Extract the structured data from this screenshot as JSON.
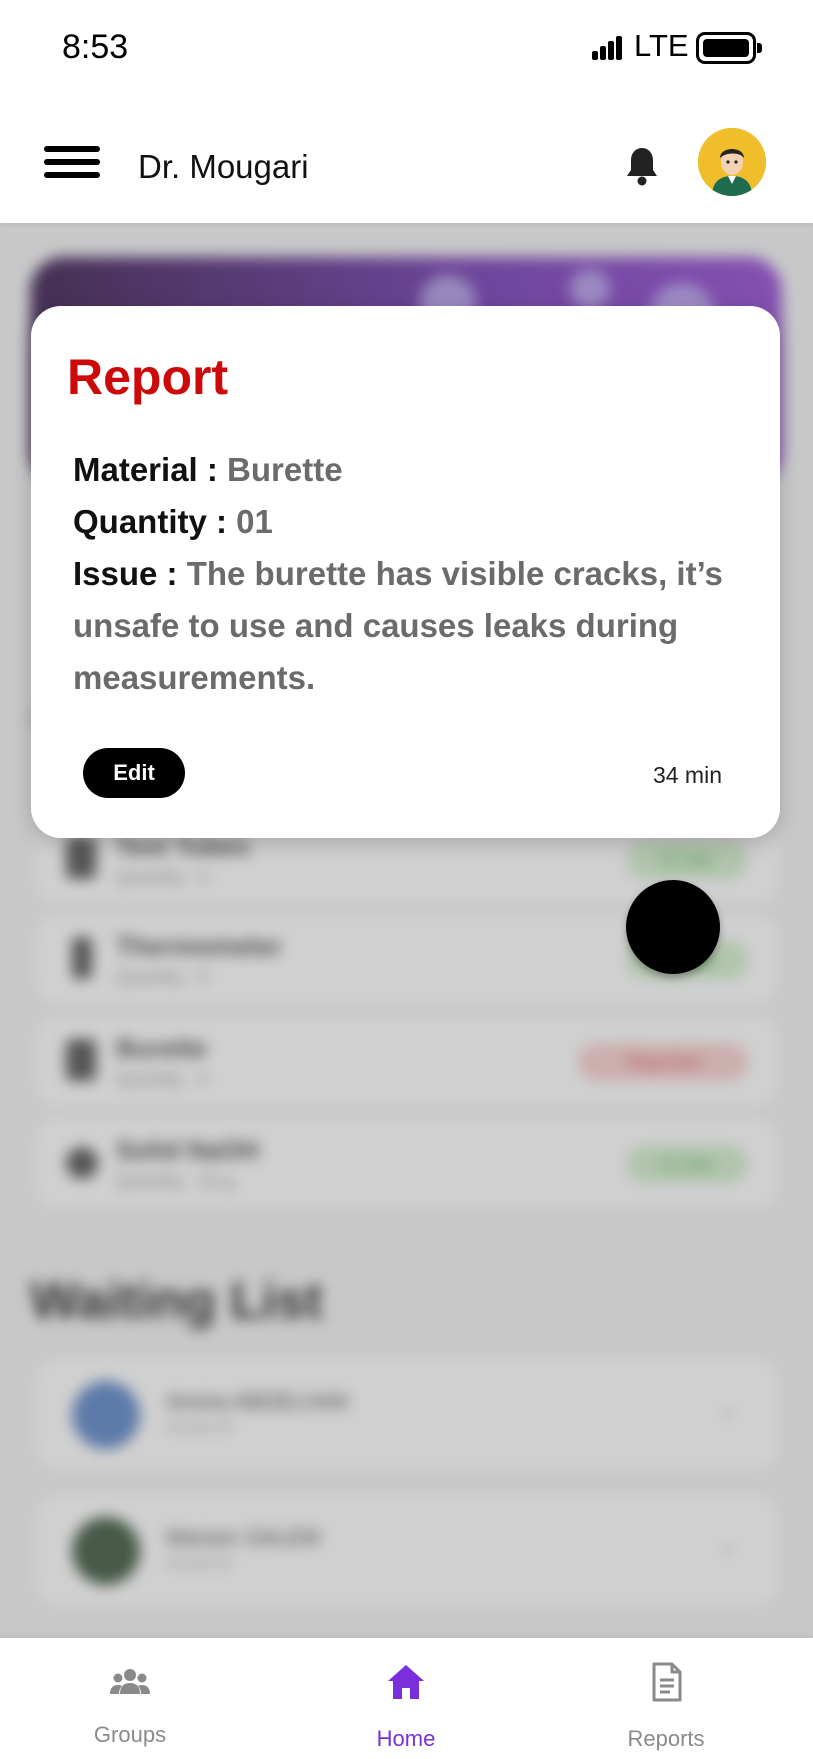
{
  "status_bar": {
    "time": "8:53",
    "network": "LTE"
  },
  "header": {
    "title": "Dr. Mougari",
    "menu_icon": "hamburger-icon",
    "bell_icon": "bell-icon",
    "avatar": "avatar"
  },
  "report": {
    "title": "Report",
    "material_label": "Material :",
    "material_value": "Burette",
    "quantity_label": "Quantity :",
    "quantity_value": "01",
    "issue_label": "Issue :",
    "issue_value": "The burette has visible cracks, it’s unsafe to use and causes leaks during measurements.",
    "edit_label": "Edit",
    "time": "34 min",
    "title_color": "#cc0a0a"
  },
  "background": {
    "materials": [
      {
        "name": "Test Tubes",
        "qty": "Quantity : 4",
        "status": "In Use",
        "status_type": "green"
      },
      {
        "name": "Thermometer",
        "qty": "Quantity : 4",
        "status": "In Use",
        "status_type": "green"
      },
      {
        "name": "Burette",
        "qty": "Quantity : 4",
        "status": "Reported",
        "status_type": "red"
      },
      {
        "name": "Solid NaOH",
        "qty": "Quantity : 15 g",
        "status": "In Use",
        "status_type": "green"
      }
    ],
    "waiting_title": "Waiting List",
    "waiting": [
      {
        "name": "Amina ABDELHAK",
        "group": "Group 03"
      },
      {
        "name": "Mariam SALEM",
        "group": "Group 01"
      }
    ]
  },
  "nav": {
    "items": [
      {
        "label": "Groups",
        "icon": "groups-icon"
      },
      {
        "label": "Home",
        "icon": "home-icon"
      },
      {
        "label": "Reports",
        "icon": "reports-icon"
      }
    ],
    "active_color": "#7b2fdc"
  }
}
